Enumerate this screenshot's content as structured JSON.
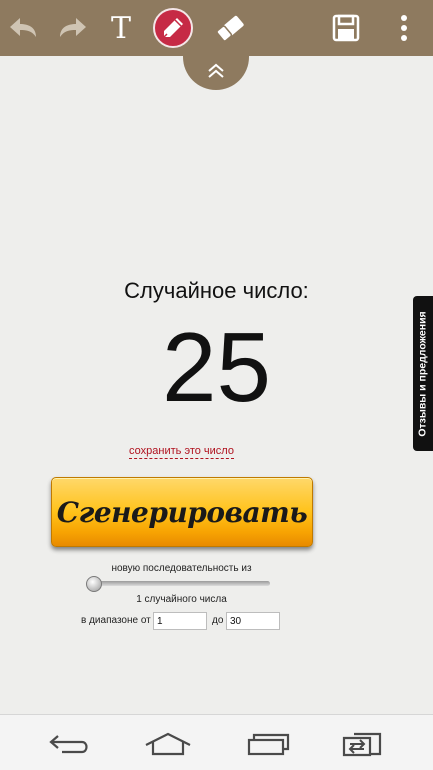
{
  "toolbar": {
    "icons": [
      "undo-icon",
      "redo-icon",
      "text-tool-icon",
      "pen-tool-icon",
      "eraser-icon",
      "save-icon",
      "more-options-icon"
    ],
    "text_tool_glyph": "T",
    "colors": {
      "bar": "#8e7a5f",
      "pen_active": "#c62a45"
    }
  },
  "pull_tab": {
    "icon": "chevron-up-icon"
  },
  "content": {
    "title": "Случайное число:",
    "number": "25",
    "save_link": "сохранить это число",
    "generate_label": "Сгенерировать",
    "sequence_label": "новую последовательность из",
    "count_label": "1 случайного числа",
    "range_from_label": "в диапазоне от",
    "range_from_value": "1",
    "range_to_label": "до",
    "range_to_value": "30",
    "slider_value": 1
  },
  "feedback_tab": "Отзывы и предложения",
  "navbar": {
    "icons": [
      "back-icon",
      "home-icon",
      "recent-apps-icon",
      "switch-window-icon"
    ]
  }
}
